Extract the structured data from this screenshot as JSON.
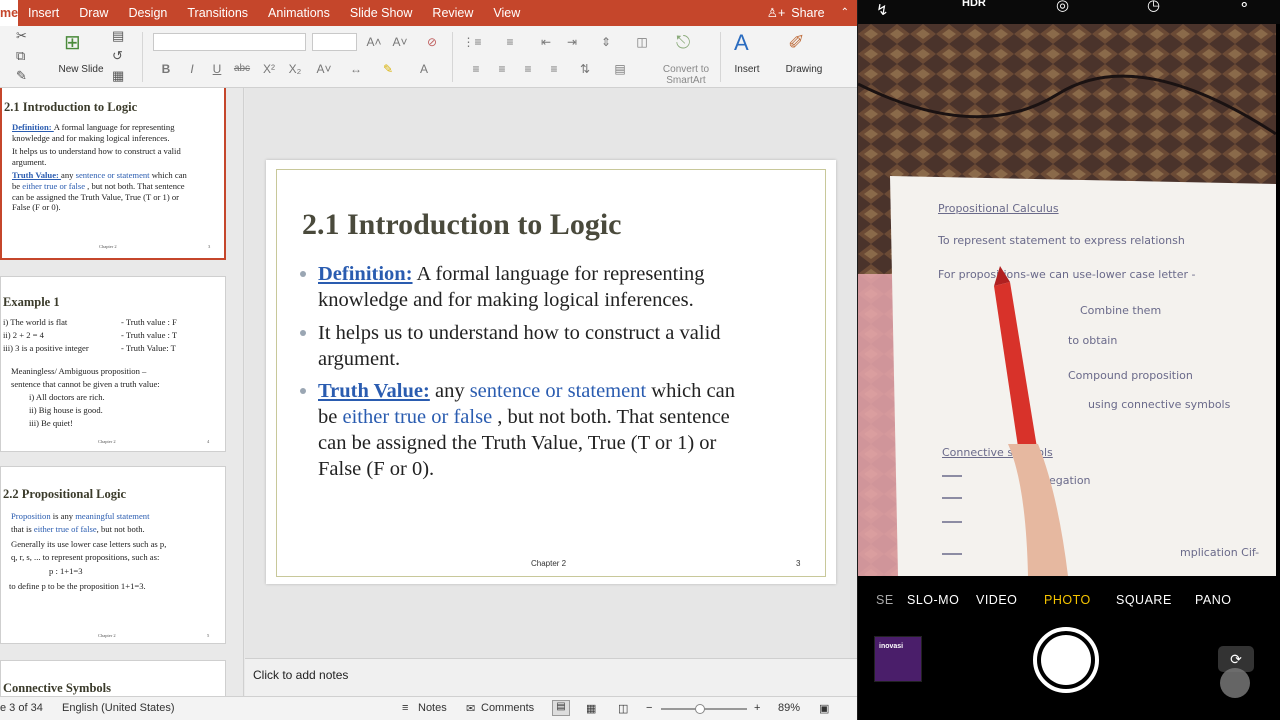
{
  "ppt": {
    "tabs": [
      "me",
      "Insert",
      "Draw",
      "Design",
      "Transitions",
      "Animations",
      "Slide Show",
      "Review",
      "View"
    ],
    "share_label": "Share",
    "ribbon": {
      "new_slide_label": "New Slide",
      "convert_label": "Convert to SmartArt",
      "insert_label": "Insert",
      "drawing_label": "Drawing",
      "format_buttons": [
        "B",
        "I",
        "U",
        "abc",
        "X²",
        "X₂"
      ]
    },
    "thumbnails": [
      {
        "title": "2.1 Introduction to Logic",
        "lines": [
          {
            "parts": [
              {
                "t": "Definition: ",
                "s": "ublue"
              },
              {
                "t": "A formal language for representing",
                "s": ""
              }
            ]
          },
          {
            "parts": [
              {
                "t": "knowledge and for making logical inferences.",
                "s": ""
              }
            ]
          },
          {
            "parts": [
              {
                "t": "It helps us to understand how to construct a valid",
                "s": ""
              }
            ]
          },
          {
            "parts": [
              {
                "t": "argument.",
                "s": ""
              }
            ]
          },
          {
            "parts": [
              {
                "t": "Truth Value: ",
                "s": "ublue"
              },
              {
                "t": "any ",
                "s": ""
              },
              {
                "t": "sentence or statement",
                "s": "blue"
              },
              {
                "t": " which can",
                "s": ""
              }
            ]
          },
          {
            "parts": [
              {
                "t": "be ",
                "s": ""
              },
              {
                "t": "either true or false",
                "s": "blue"
              },
              {
                "t": " , but not both. That sentence",
                "s": ""
              }
            ]
          },
          {
            "parts": [
              {
                "t": "can be assigned the Truth Value, True (T or 1) or",
                "s": ""
              }
            ]
          },
          {
            "parts": [
              {
                "t": "False (F or 0).",
                "s": ""
              }
            ]
          }
        ],
        "footer": "Chapter 2",
        "page": "3"
      },
      {
        "title": "Example 1",
        "lines": [
          {
            "parts": [
              {
                "t": "i) The world is flat",
                "s": ""
              }
            ]
          },
          {
            "parts": [
              {
                "t": "ii) 2 + 2 = 4",
                "s": ""
              }
            ]
          },
          {
            "parts": [
              {
                "t": "iii) 3 is a positive integer",
                "s": ""
              }
            ]
          },
          {
            "parts": [
              {
                "t": "Meaningless/ Ambiguous proposition –",
                "s": ""
              }
            ]
          },
          {
            "parts": [
              {
                "t": "sentence that cannot be given a truth value:",
                "s": ""
              }
            ]
          },
          {
            "parts": [
              {
                "t": "i)  All doctors are rich.",
                "s": ""
              }
            ]
          },
          {
            "parts": [
              {
                "t": "ii) Big house is good.",
                "s": ""
              }
            ]
          },
          {
            "parts": [
              {
                "t": "iii) Be quiet!",
                "s": ""
              }
            ]
          }
        ],
        "truth": [
          "-  Truth value : F",
          "-  Truth value : T",
          "-  Truth Value: T"
        ],
        "footer": "Chapter 2",
        "page": "4"
      },
      {
        "title": "2.2 Propositional Logic",
        "lines": [
          {
            "parts": [
              {
                "t": "Proposition",
                "s": "blue"
              },
              {
                "t": " is any ",
                "s": ""
              },
              {
                "t": "meaningful statement",
                "s": "blue"
              }
            ]
          },
          {
            "parts": [
              {
                "t": "that is ",
                "s": ""
              },
              {
                "t": "either true of false",
                "s": "blue"
              },
              {
                "t": ", but not both.",
                "s": ""
              }
            ]
          },
          {
            "parts": [
              {
                "t": "Generally its use lower case letters such as p,",
                "s": ""
              }
            ]
          },
          {
            "parts": [
              {
                "t": "q, r, s, ... to represent propositions, such as:",
                "s": ""
              }
            ]
          },
          {
            "parts": [
              {
                "t": "p : 1+1=3",
                "s": ""
              }
            ]
          },
          {
            "parts": [
              {
                "t": "to define p to be the proposition 1+1=3.",
                "s": ""
              }
            ]
          }
        ],
        "footer": "Chapter 2",
        "page": "5"
      },
      {
        "title": "Connective Symbols"
      }
    ],
    "slide": {
      "title": "2.1 Introduction to Logic",
      "b1_term": "Definition:",
      "b1_rest": " A formal language for representing",
      "b1_l2": "knowledge and for making logical inferences.",
      "b2_l1": "It helps us to understand how to construct a valid",
      "b2_l2": "argument.",
      "b3_term": "Truth Value:",
      "b3_any": " any ",
      "b3_sos": "sentence or statement",
      "b3_wc": " which can",
      "b3_be": "be ",
      "b3_etf": "either true or false",
      "b3_rest": " , but not both. That sentence",
      "b3_l3": "can be assigned the Truth Value, True (T or 1) or",
      "b3_l4": "False (F or 0).",
      "footer": "Chapter 2",
      "page_number": "3"
    },
    "notes_placeholder": "Click to add notes",
    "status": {
      "slide_pos": "e 3 of 34",
      "language": "English (United States)",
      "notes_label": "Notes",
      "comments_label": "Comments",
      "zoom": "89%",
      "zoom_fraction": 0.45
    }
  },
  "camera": {
    "top_labels": [
      "HDR"
    ],
    "modes": [
      "SE",
      "SLO-MO",
      "VIDEO",
      "PHOTO",
      "SQUARE",
      "PANO"
    ],
    "active_mode": "PHOTO",
    "paper_lines": [
      "Propositional Calculus",
      "To represent statement to express relationsh",
      "For propositions-we can use-lower case letter -",
      "Combine them",
      "to obtain",
      "Compound proposition",
      "using connective symbols",
      "Connective symbols",
      "negation",
      "mplication Cif-"
    ],
    "thumb_brand": "inovasi"
  }
}
